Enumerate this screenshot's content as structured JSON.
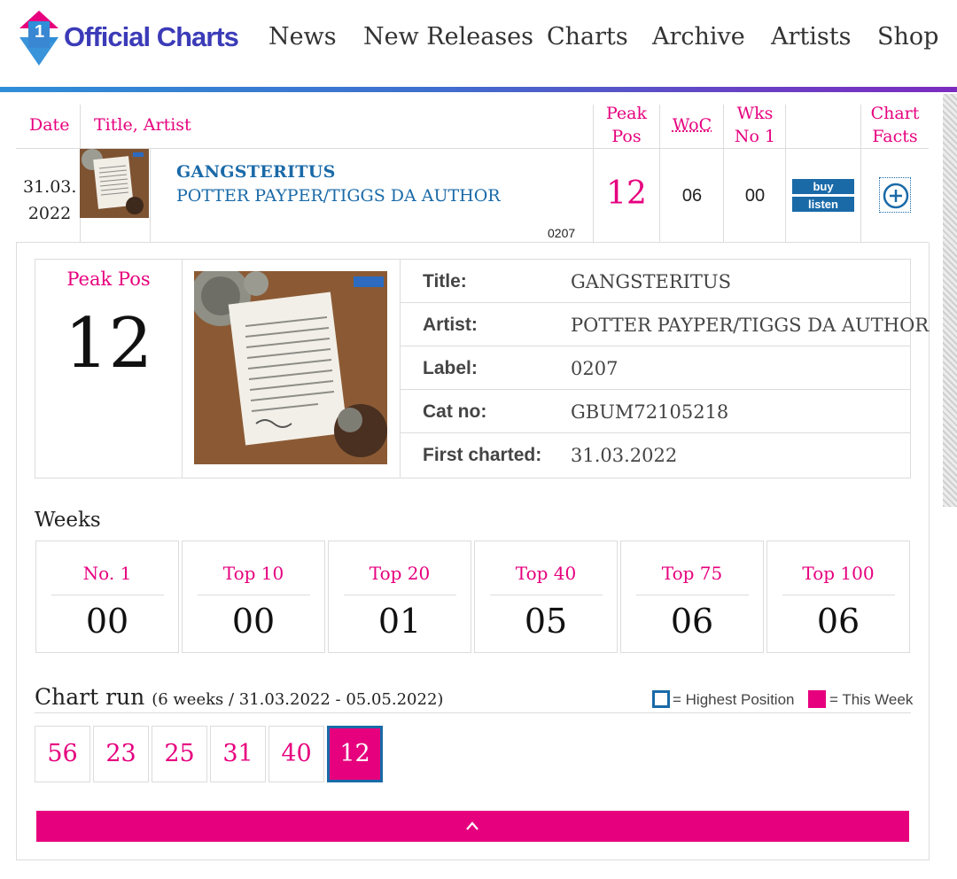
{
  "brand": {
    "name": "Official Charts",
    "colors": {
      "pink": "#e6007e",
      "blue": "#1a6aa8",
      "logo_purple": "#3b3bb8",
      "logo_blue_arrow": "#2f8ed8",
      "logo_pink_arrow": "#e6007e"
    }
  },
  "nav": {
    "items": [
      "News",
      "New Releases",
      "Charts",
      "Archive",
      "Artists",
      "Shop"
    ]
  },
  "table": {
    "headers": {
      "date": "Date",
      "title_artist": "Title, Artist",
      "peak_pos_1": "Peak",
      "peak_pos_2": "Pos",
      "woc": "WoC",
      "wks_no1_1": "Wks",
      "wks_no1_2": "No 1",
      "chart_facts_1": "Chart",
      "chart_facts_2": "Facts"
    },
    "row": {
      "date_1": "31.03.",
      "date_2": "2022",
      "title": "GANGSTERITUS",
      "artist": "POTTER PAYPER/TIGGS DA AUTHOR",
      "label": "0207",
      "peak": "12",
      "woc": "06",
      "wks_no1": "00",
      "buy_label": "buy",
      "listen_label": "listen",
      "facts_icon": "plus-circle-icon"
    }
  },
  "details": {
    "peak_label": "Peak Pos",
    "peak_value": "12",
    "info": [
      {
        "key": "Title:",
        "value": "GANGSTERITUS"
      },
      {
        "key": "Artist:",
        "value": "POTTER PAYPER/TIGGS DA AUTHOR"
      },
      {
        "key": "Label:",
        "value": "0207"
      },
      {
        "key": "Cat no:",
        "value": "GBUM72105218"
      },
      {
        "key": "First charted:",
        "value": "31.03.2022"
      }
    ],
    "weeks_heading": "Weeks",
    "weeks": [
      {
        "label": "No. 1",
        "value": "00"
      },
      {
        "label": "Top 10",
        "value": "00"
      },
      {
        "label": "Top 20",
        "value": "01"
      },
      {
        "label": "Top 40",
        "value": "05"
      },
      {
        "label": "Top 75",
        "value": "06"
      },
      {
        "label": "Top 100",
        "value": "06"
      }
    ],
    "chart_run": {
      "heading": "Chart run",
      "subheading": "(6 weeks / 31.03.2022 - 05.05.2022)",
      "legend_highest": "= Highest Position",
      "legend_this_week": "= This Week",
      "positions": [
        "56",
        "23",
        "25",
        "31",
        "40",
        "12"
      ],
      "current_index": 5
    },
    "collapse_icon": "chevron-up-icon"
  }
}
